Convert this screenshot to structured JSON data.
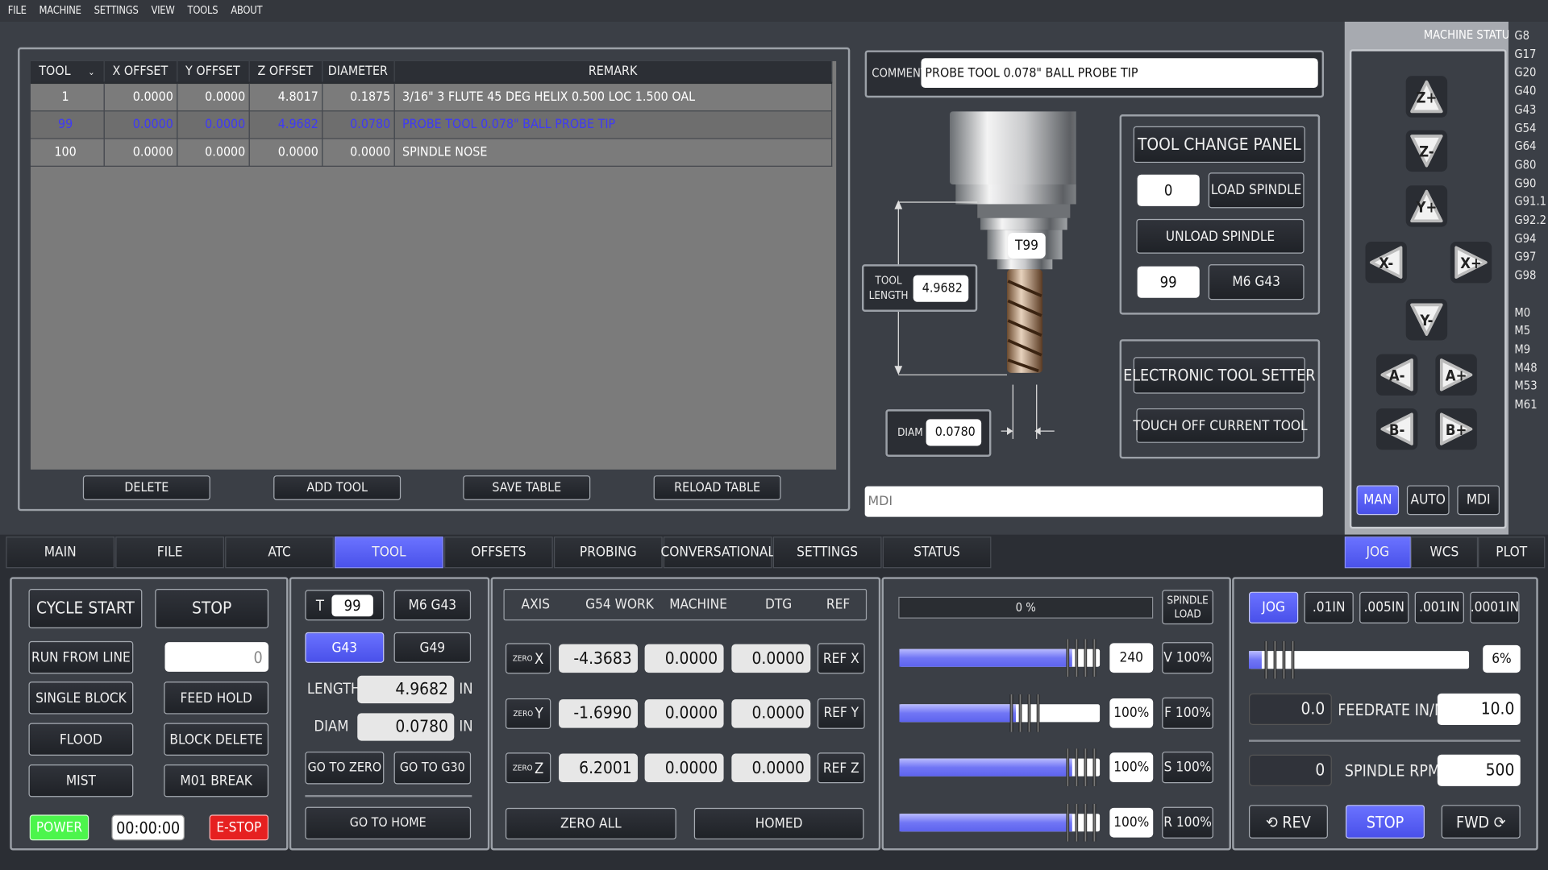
{
  "menu": [
    "FILE",
    "MACHINE",
    "SETTINGS",
    "VIEW",
    "TOOLS",
    "ABOUT"
  ],
  "tool_table": {
    "headers": [
      "TOOL",
      "X OFFSET",
      "Y OFFSET",
      "Z OFFSET",
      "DIAMETER",
      "REMARK"
    ],
    "rows": [
      [
        "1",
        "0.0000",
        "0.0000",
        "4.8017",
        "0.1875",
        "3/16\" 3 FLUTE 45 DEG HELIX 0.500 LOC 1.500 OAL"
      ],
      [
        "99",
        "0.0000",
        "0.0000",
        "4.9682",
        "0.0780",
        "PROBE TOOL 0.078\" BALL PROBE TIP"
      ],
      [
        "100",
        "0.0000",
        "0.0000",
        "0.0000",
        "0.0000",
        "SPINDLE NOSE"
      ]
    ],
    "buttons": [
      "DELETE",
      "ADD TOOL",
      "SAVE TABLE",
      "RELOAD TABLE"
    ]
  },
  "comment": {
    "label": "COMMENT",
    "value": "PROBE TOOL 0.078\" BALL PROBE TIP"
  },
  "tool_image": {
    "tool_number": "T99",
    "length_label": "TOOL LENGTH",
    "length": "4.9682",
    "diam_label": "DIAM",
    "diam": "0.0780"
  },
  "tool_change": {
    "title": "TOOL CHANGE PANEL",
    "load_value": "0",
    "load_label": "LOAD SPINDLE",
    "unload_label": "UNLOAD SPINDLE",
    "m6_value": "99",
    "m6_label": "M6 G43"
  },
  "tool_setter": {
    "title": "ELECTRONIC TOOL SETTER",
    "touch_label": "TOUCH OFF CURRENT TOOL"
  },
  "mdi_placeholder": "MDI",
  "machine_status": {
    "label": "MACHINE STATUS:",
    "codes": [
      "G8",
      "G17",
      "G20",
      "G40",
      "G43",
      "G54",
      "G64",
      "G80",
      "G90",
      "G91.1",
      "G92.2",
      "G94",
      "G97",
      "G98",
      "",
      "M0",
      "M5",
      "M9",
      "M48",
      "M53",
      "M61"
    ]
  },
  "jog_keys": [
    "Z+",
    "Z-",
    "Y+",
    "X-",
    "X+",
    "Y-",
    "A-",
    "A+",
    "B-",
    "B+"
  ],
  "mode_buttons": [
    "MAN",
    "AUTO",
    "MDI"
  ],
  "tabs": [
    "MAIN",
    "FILE",
    "ATC",
    "TOOL",
    "OFFSETS",
    "PROBING",
    "CONVERSATIONAL",
    "SETTINGS",
    "STATUS"
  ],
  "right_tabs": [
    "JOG",
    "WCS",
    "PLOT"
  ],
  "program": {
    "cycle_start": "CYCLE START",
    "stop": "STOP",
    "run_from_line": "RUN FROM LINE",
    "line_value": "0",
    "single_block": "SINGLE BLOCK",
    "feed_hold": "FEED HOLD",
    "flood": "FLOOD",
    "block_delete": "BLOCK DELETE",
    "mist": "MIST",
    "m01_break": "M01 BREAK",
    "power": "POWER",
    "timer": "00:00:00",
    "estop": "E-STOP"
  },
  "tool_ctrl": {
    "t_label": "T",
    "t_value": "99",
    "m6g43": "M6 G43",
    "g43": "G43",
    "g49": "G49",
    "length_label": "LENGTH",
    "length": "4.9682",
    "unit": "IN",
    "diam_label": "DIAM",
    "diam": "0.0780",
    "go_zero": "GO TO ZERO",
    "go_g30": "GO TO G30",
    "go_home": "GO TO HOME"
  },
  "dro": {
    "headers": [
      "AXIS",
      "G54 WORK",
      "MACHINE",
      "DTG",
      "REF"
    ],
    "zero_label": "ZERO",
    "axes": [
      {
        "axis": "X",
        "work": "-4.3683",
        "machine": "0.0000",
        "dtg": "0.0000",
        "ref": "REF X"
      },
      {
        "axis": "Y",
        "work": "-1.6990",
        "machine": "0.0000",
        "dtg": "0.0000",
        "ref": "REF Y"
      },
      {
        "axis": "Z",
        "work": "6.2001",
        "machine": "0.0000",
        "dtg": "0.0000",
        "ref": "REF Z"
      }
    ],
    "zero_all": "ZERO ALL",
    "homed": "HOMED"
  },
  "overrides": {
    "load_text": "0 %",
    "spindle_load_label": "SPINDLE LOAD",
    "rows": [
      {
        "value": "240",
        "button": "V 100%",
        "fraction": 0.86
      },
      {
        "value": "100%",
        "button": "F 100%",
        "fraction": 0.58
      },
      {
        "value": "100%",
        "button": "S 100%",
        "fraction": 0.86
      },
      {
        "value": "100%",
        "button": "R 100%",
        "fraction": 0.86
      }
    ]
  },
  "jog_panel": {
    "jog": "JOG",
    "increments": [
      ".01IN",
      ".005IN",
      ".001IN",
      ".0001IN"
    ],
    "jog_percent": "6%",
    "jog_fraction": 0.06,
    "feed_actual": "0.0",
    "feed_label": "FEEDRATE IN/M",
    "feed_set": "10.0",
    "rpm_actual": "0",
    "rpm_label": "SPINDLE RPM",
    "rpm_set": "500",
    "rev": "⟲ REV",
    "stop": "STOP",
    "fwd": "FWD ⟳"
  },
  "colors": {
    "accent": "#5058f0",
    "power": "#4cf54c",
    "estop": "#e62020",
    "background": "#3b3f46"
  }
}
